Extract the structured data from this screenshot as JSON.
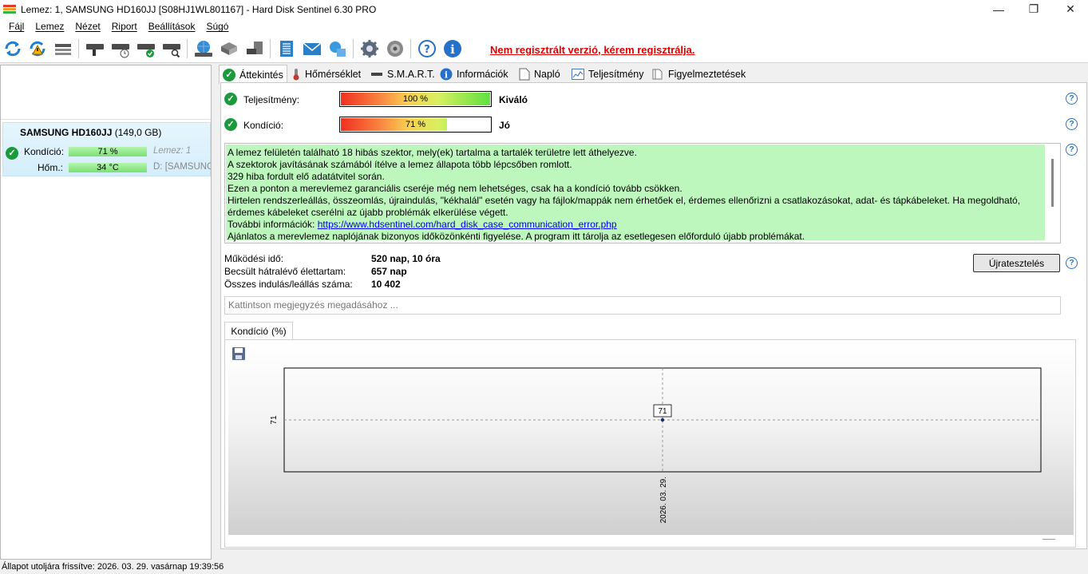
{
  "window": {
    "title": "Lemez: 1, SAMSUNG HD160JJ [S08HJ1WL801167]  -  Hard Disk Sentinel 6.30 PRO",
    "min_glyph": "—",
    "restore_glyph": "❐",
    "close_glyph": "✕"
  },
  "menu": [
    "Fájl",
    "Lemez",
    "Nézet",
    "Riport",
    "Beállítások",
    "Súgó"
  ],
  "toolbar": {
    "registration_notice": "Nem regisztrált verzió, kérem regisztrálja.",
    "icons": [
      "refresh-icon",
      "refresh-warning-icon",
      "disk-list-icon",
      "disk-icon",
      "disk-schedule-icon",
      "disk-ok-icon",
      "disk-search-icon",
      "globe-icon",
      "network-disk-icon",
      "server-disk-icon",
      "report-icon",
      "email-icon",
      "send-report-icon",
      "settings-icon",
      "sound-icon",
      "help-icon",
      "info-icon"
    ]
  },
  "disk": {
    "name": "SAMSUNG HD160JJ",
    "size": "(149,0 GB)",
    "condition_label": "Kondíció:",
    "condition_value": "71 %",
    "condition_pct": 71,
    "disk_index": "Lemez: 1",
    "temp_label": "Hőm.:",
    "temp_value": "34 °C",
    "drive_letter": "D: [SAMSUNG"
  },
  "tabs": [
    {
      "label": "Áttekintés",
      "icon": "check-icon"
    },
    {
      "label": "Hőmérséklet",
      "icon": "thermometer-icon"
    },
    {
      "label": "S.M.A.R.T.",
      "icon": "smart-icon"
    },
    {
      "label": "Információk",
      "icon": "info-icon"
    },
    {
      "label": "Napló",
      "icon": "log-icon"
    },
    {
      "label": "Teljesítmény",
      "icon": "performance-icon"
    },
    {
      "label": "Figyelmeztetések",
      "icon": "alerts-icon"
    }
  ],
  "overview": {
    "performance_label": "Teljesítmény:",
    "performance_value": "100 %",
    "performance_pct": 100,
    "performance_rating": "Kiváló",
    "health_label": "Kondíció:",
    "health_value": "71 %",
    "health_pct": 71,
    "health_rating": "Jó",
    "message_lines": [
      "A lemez felületén található 18 hibás szektor, mely(ek) tartalma a tartalék területre lett áthelyezve.",
      "A szektorok javításának számából ítélve a lemez állapota több lépcsőben romlott.",
      "329 hiba fordult elő adatátvitel során.",
      "Ezen a ponton a merevlemez garanciális cseréje még nem lehetséges, csak ha a kondíció tovább csökken.",
      "Hirtelen rendszerleállás, összeomlás, újraindulás, \"kékhalál\" esetén vagy ha fájlok/mappák nem érhetőek el, érdemes ellenőrizni a csatlakozásokat, adat- és tápkábeleket. Ha megoldható, érdemes kábeleket cserélni az újabb problémák elkerülése végett."
    ],
    "more_info_label": "További információk:",
    "more_info_link": "https://www.hdsentinel.com/hard_disk_case_communication_error.php",
    "message_last": "Ajánlatos a merevlemez naplójának bizonyos időközönkénti figyelése. A program itt tárolja az esetlegesen előforduló újabb problémákat.",
    "power_on_label": "Működési idő:",
    "power_on_value": "520 nap, 10 óra",
    "lifetime_label": "Becsült hátralévő élettartam:",
    "lifetime_value": "657 nap",
    "startstop_label": "Összes indulás/leállás száma:",
    "startstop_value": "10 402",
    "retest_button": "Újratesztelés",
    "note_placeholder": "Kattintson megjegyzés megadásához ...",
    "chart_tab_label": "Kondíció",
    "chart_tab_unit": "(%)"
  },
  "chart_data": {
    "type": "line",
    "x": [
      "2026. 03. 29."
    ],
    "series": [
      {
        "values": [
          71
        ]
      }
    ],
    "ytick": "71",
    "xtick": "2026. 03. 29.",
    "point_label": "71",
    "grid": true
  },
  "status": {
    "text": "Állapot utoljára frissítve: 2026. 03. 29. vasárnap 19:39:56"
  }
}
